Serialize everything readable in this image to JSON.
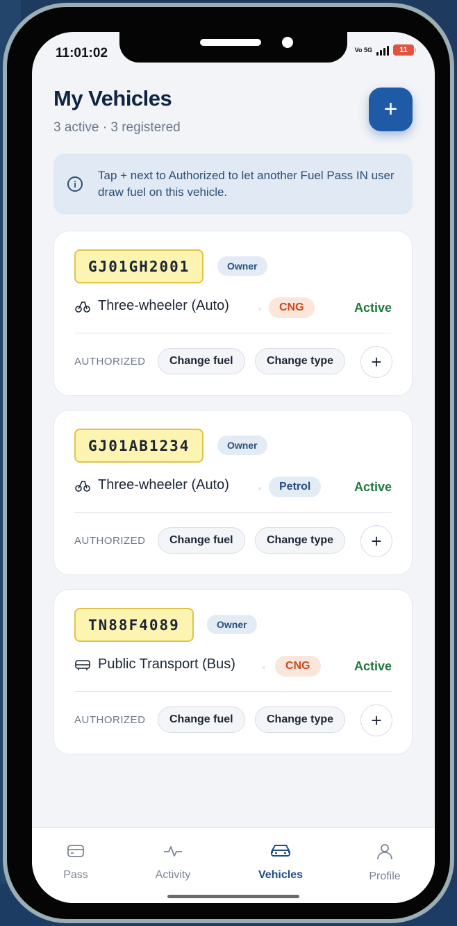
{
  "status_bar": {
    "time": "11:01:02",
    "network": "Vo 5G",
    "battery": "11"
  },
  "header": {
    "title": "My Vehicles",
    "subtitle": "3 active · 3 registered",
    "add_button": "+"
  },
  "info": {
    "text": "Tap + next to Authorized to let another Fuel Pass IN user draw fuel on this vehicle.",
    "icon": "info-icon"
  },
  "vehicles": [
    {
      "plate": "GJ01GH2001",
      "role": "Owner",
      "type": "Three-wheeler (Auto)",
      "type_icon": "auto-rickshaw-icon",
      "fuel": "CNG",
      "status": "Active",
      "authorized_label": "AUTHORIZED",
      "change_fuel": "Change fuel",
      "change_type": "Change type",
      "add": "+"
    },
    {
      "plate": "GJ01AB1234",
      "role": "Owner",
      "type": "Three-wheeler (Auto)",
      "type_icon": "auto-rickshaw-icon",
      "fuel": "Petrol",
      "status": "Active",
      "authorized_label": "AUTHORIZED",
      "change_fuel": "Change fuel",
      "change_type": "Change type",
      "add": "+"
    },
    {
      "plate": "TN88F4089",
      "role": "Owner",
      "type": "Public Transport (Bus)",
      "type_icon": "bus-icon",
      "fuel": "CNG",
      "status": "Active",
      "authorized_label": "AUTHORIZED",
      "change_fuel": "Change fuel",
      "change_type": "Change type",
      "add": "+"
    }
  ],
  "tabs": [
    {
      "label": "Pass",
      "icon": "card-icon"
    },
    {
      "label": "Activity",
      "icon": "pulse-icon"
    },
    {
      "label": "Vehicles",
      "icon": "car-icon",
      "active": true
    },
    {
      "label": "Profile",
      "icon": "person-icon"
    }
  ],
  "colors": {
    "accent": "#1e5aa5",
    "active_green": "#1f7a3e",
    "cng_orange": "#c84a1e",
    "plate_yellow": "#fcf4b0"
  }
}
